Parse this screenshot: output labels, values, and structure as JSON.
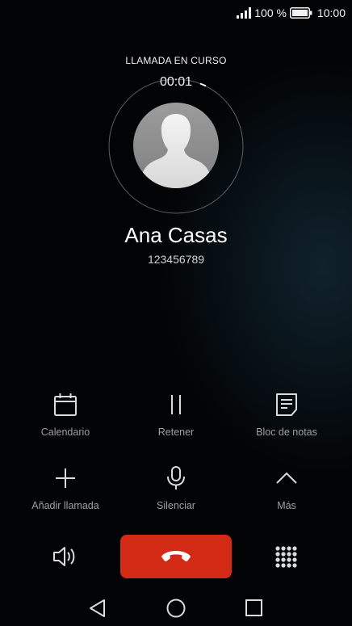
{
  "status_bar": {
    "battery_text": "100 %",
    "time": "10:00",
    "signal_icon": "signal-bars-icon",
    "battery_icon": "battery-full-icon"
  },
  "call": {
    "state_label": "LLAMADA EN CURSO",
    "duration": "00:01",
    "contact_name": "Ana Casas",
    "phone_number": "123456789",
    "avatar_icon": "contact-silhouette-icon"
  },
  "actions": [
    {
      "label": "Calendario",
      "icon": "calendar-icon"
    },
    {
      "label": "Retener",
      "icon": "pause-icon"
    },
    {
      "label": "Bloc de notas",
      "icon": "notes-icon"
    },
    {
      "label": "Añadir llamada",
      "icon": "add-icon"
    },
    {
      "label": "Silenciar",
      "icon": "microphone-icon"
    },
    {
      "label": "Más",
      "icon": "chevron-up-icon"
    }
  ],
  "bottom_controls": {
    "speaker_icon": "speaker-icon",
    "end_call_icon": "phone-hangup-icon",
    "dialpad_icon": "dialpad-icon"
  },
  "navigation": {
    "back_icon": "back-triangle-icon",
    "home_icon": "home-circle-icon",
    "recents_icon": "recents-square-icon"
  },
  "colors": {
    "end_call": "#d22a14",
    "label_gray": "#9aa0a4",
    "icon_gray": "#d9dcde"
  }
}
